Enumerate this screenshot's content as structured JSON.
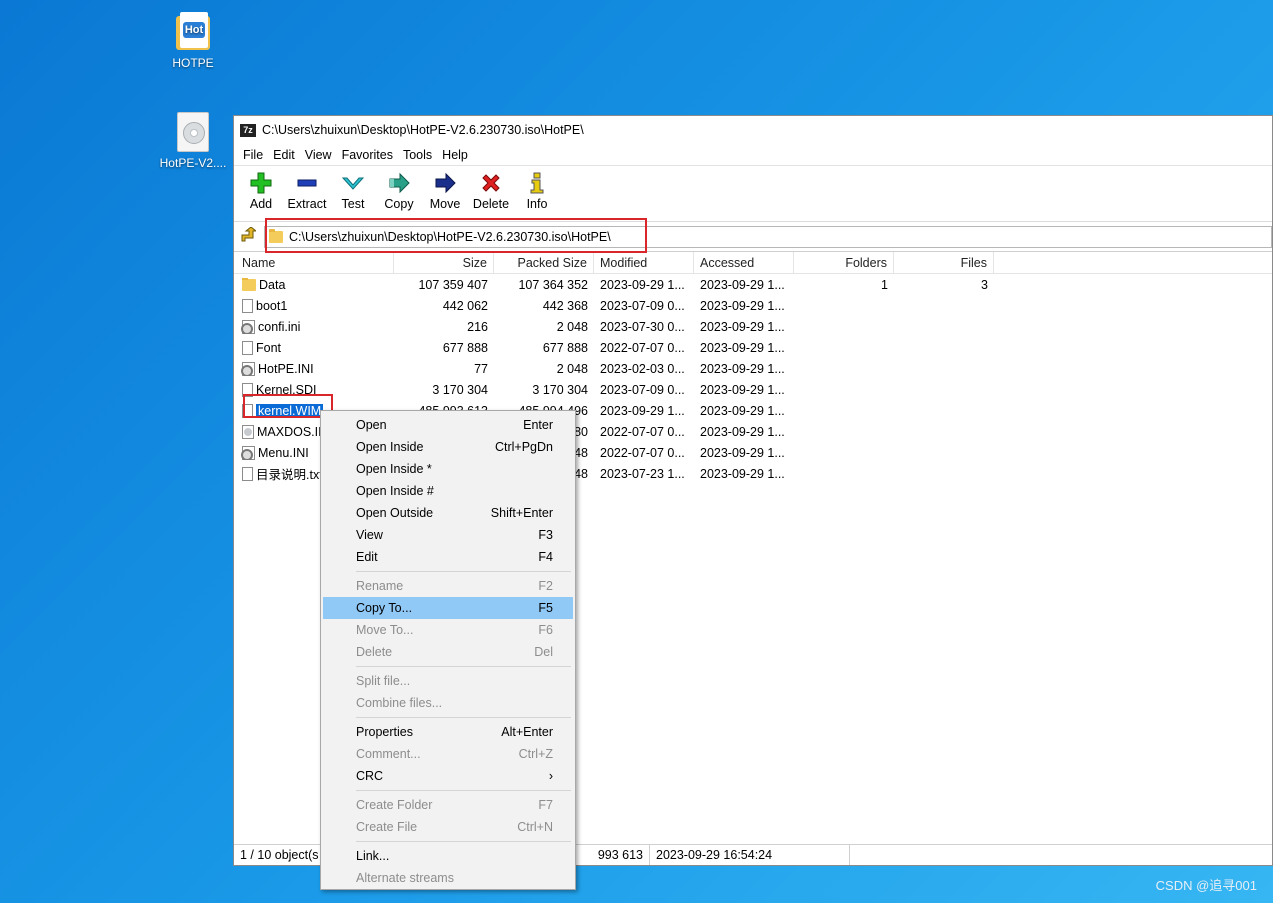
{
  "desktop": {
    "icons": [
      {
        "label": "HOTPE",
        "badge": "Hot"
      },
      {
        "label": "HotPE-V2...."
      }
    ],
    "watermark": "CSDN @追寻001"
  },
  "window": {
    "title": "C:\\Users\\zhuixun\\Desktop\\HotPE-V2.6.230730.iso\\HotPE\\",
    "app_icon": "7z",
    "menu": [
      "File",
      "Edit",
      "View",
      "Favorites",
      "Tools",
      "Help"
    ],
    "toolbar": [
      {
        "label": "Add",
        "icon": "plus-icon",
        "color": "#22b022"
      },
      {
        "label": "Extract",
        "icon": "minus-icon",
        "color": "#1f3fb8"
      },
      {
        "label": "Test",
        "icon": "check-icon",
        "color": "#26b6c8"
      },
      {
        "label": "Copy",
        "icon": "copy-arrow-icon",
        "color": "#2aa088"
      },
      {
        "label": "Move",
        "icon": "move-arrow-icon",
        "color": "#1a2e8c"
      },
      {
        "label": "Delete",
        "icon": "delete-icon",
        "color": "#e02020"
      },
      {
        "label": "Info",
        "icon": "info-icon",
        "color": "#c8a800"
      }
    ],
    "address": "C:\\Users\\zhuixun\\Desktop\\HotPE-V2.6.230730.iso\\HotPE\\",
    "columns": [
      "Name",
      "Size",
      "Packed Size",
      "Modified",
      "Accessed",
      "Folders",
      "Files"
    ],
    "rows": [
      {
        "name": "Data",
        "icon": "folder-icon",
        "size": "107 359 407",
        "packed": "107 364 352",
        "modified": "2023-09-29 1...",
        "accessed": "2023-09-29 1...",
        "folders": "1",
        "files": "3"
      },
      {
        "name": "boot1",
        "icon": "file-icon",
        "size": "442 062",
        "packed": "442 368",
        "modified": "2023-07-09 0...",
        "accessed": "2023-09-29 1...",
        "folders": "",
        "files": ""
      },
      {
        "name": "confi.ini",
        "icon": "settings-file-icon",
        "size": "216",
        "packed": "2 048",
        "modified": "2023-07-30 0...",
        "accessed": "2023-09-29 1...",
        "folders": "",
        "files": ""
      },
      {
        "name": "Font",
        "icon": "file-icon",
        "size": "677 888",
        "packed": "677 888",
        "modified": "2022-07-07 0...",
        "accessed": "2023-09-29 1...",
        "folders": "",
        "files": ""
      },
      {
        "name": "HotPE.INI",
        "icon": "settings-file-icon",
        "size": "77",
        "packed": "2 048",
        "modified": "2023-02-03 0...",
        "accessed": "2023-09-29 1...",
        "folders": "",
        "files": ""
      },
      {
        "name": "Kernel.SDI",
        "icon": "file-icon",
        "size": "3 170 304",
        "packed": "3 170 304",
        "modified": "2023-07-09 0...",
        "accessed": "2023-09-29 1...",
        "folders": "",
        "files": ""
      },
      {
        "name": "kernel.WIM",
        "icon": "file-icon",
        "size": "485 993 613",
        "packed": "485 994 496",
        "modified": "2023-09-29 1...",
        "accessed": "2023-09-29 1...",
        "folders": "",
        "files": "",
        "selected": true
      },
      {
        "name": "MAXDOS.II",
        "icon": "disc-file-icon",
        "size": "",
        "packed": "80",
        "modified": "2022-07-07 0...",
        "accessed": "2023-09-29 1...",
        "folders": "",
        "files": ""
      },
      {
        "name": "Menu.INI",
        "icon": "settings-file-icon",
        "size": "",
        "packed": "48",
        "modified": "2022-07-07 0...",
        "accessed": "2023-09-29 1...",
        "folders": "",
        "files": ""
      },
      {
        "name": "目录说明.txt",
        "icon": "text-file-icon",
        "size": "",
        "packed": "48",
        "modified": "2023-07-23 1...",
        "accessed": "2023-09-29 1...",
        "folders": "",
        "files": ""
      }
    ],
    "status": {
      "objects": "1 / 10 object(s",
      "size": "993 613",
      "date": "2023-09-29 16:54:24"
    }
  },
  "context_menu": [
    {
      "label": "Open",
      "shortcut": "Enter"
    },
    {
      "label": "Open Inside",
      "shortcut": "Ctrl+PgDn"
    },
    {
      "label": "Open Inside *",
      "shortcut": ""
    },
    {
      "label": "Open Inside #",
      "shortcut": ""
    },
    {
      "label": "Open Outside",
      "shortcut": "Shift+Enter"
    },
    {
      "label": "View",
      "shortcut": "F3"
    },
    {
      "label": "Edit",
      "shortcut": "F4"
    },
    {
      "sep": true
    },
    {
      "label": "Rename",
      "shortcut": "F2",
      "disabled": true
    },
    {
      "label": "Copy To...",
      "shortcut": "F5",
      "highlight": true
    },
    {
      "label": "Move To...",
      "shortcut": "F6",
      "disabled": true
    },
    {
      "label": "Delete",
      "shortcut": "Del",
      "disabled": true
    },
    {
      "sep": true
    },
    {
      "label": "Split file...",
      "shortcut": "",
      "disabled": true
    },
    {
      "label": "Combine files...",
      "shortcut": "",
      "disabled": true
    },
    {
      "sep": true
    },
    {
      "label": "Properties",
      "shortcut": "Alt+Enter"
    },
    {
      "label": "Comment...",
      "shortcut": "Ctrl+Z",
      "disabled": true
    },
    {
      "label": "CRC",
      "shortcut": "›"
    },
    {
      "sep": true
    },
    {
      "label": "Create Folder",
      "shortcut": "F7",
      "disabled": true
    },
    {
      "label": "Create File",
      "shortcut": "Ctrl+N",
      "disabled": true
    },
    {
      "sep": true
    },
    {
      "label": "Link...",
      "shortcut": ""
    },
    {
      "label": "Alternate streams",
      "shortcut": "",
      "disabled": true
    }
  ]
}
